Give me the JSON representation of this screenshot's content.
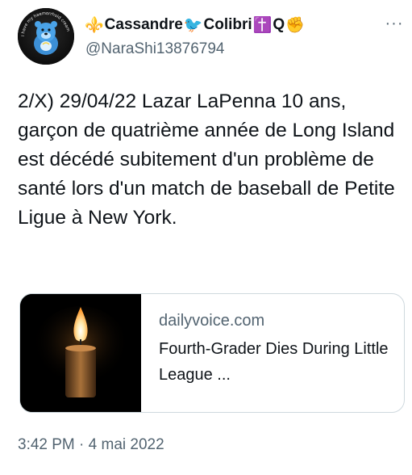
{
  "author": {
    "name_part1": "Cassandre",
    "name_part2": "Colibri",
    "name_part3": "Q",
    "handle": "@NaraShi13876794",
    "emojis": {
      "fleur": "⚜️",
      "bird": "🐦",
      "cross": "✝️",
      "hand": "✊"
    },
    "avatar_text": "I have my haemorrhoid cream"
  },
  "more_label": "···",
  "tweet": {
    "text": "2/X) 29/04/22 Lazar LaPenna 10 ans, garçon de quatrième année de Long Island est décédé subitement d'un problème de santé lors d'un match de baseball de Petite Ligue à New York."
  },
  "card": {
    "domain": "dailyvoice.com",
    "title": "Fourth-Grader Dies During Little League ...",
    "thumbnail_icon": "candle-icon"
  },
  "meta": {
    "timestamp": "3:42 PM · 4 mai 2022"
  },
  "colors": {
    "text": "#0f1419",
    "secondary": "#536471",
    "border": "#cfd9de"
  }
}
